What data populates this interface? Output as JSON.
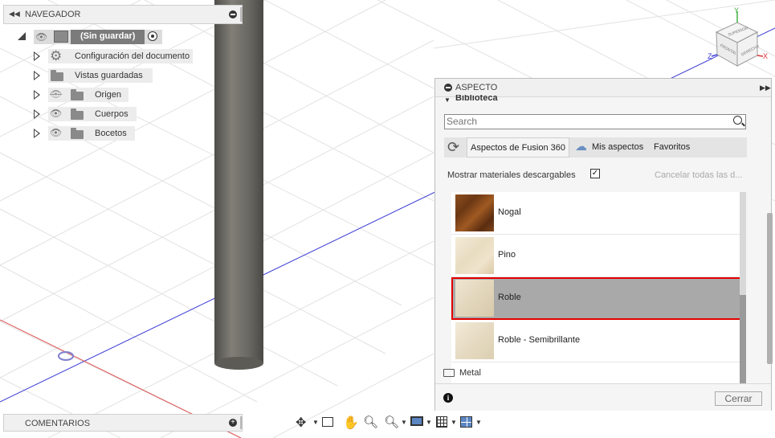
{
  "navigator": {
    "title": "NAVEGADOR",
    "root_label": "(Sin guardar)",
    "items": [
      {
        "label": "Configuración del documento",
        "icon": "gear-icon"
      },
      {
        "label": "Vistas guardadas",
        "icon": "folder-icon"
      },
      {
        "label": "Origen",
        "icon": "folder-icon",
        "visibility": "hidden"
      },
      {
        "label": "Cuerpos",
        "icon": "folder-icon",
        "visibility": "visible"
      },
      {
        "label": "Bocetos",
        "icon": "folder-icon",
        "visibility": "visible"
      }
    ]
  },
  "viewcube": {
    "faces": [
      "SUPERIOR",
      "FRONTAL",
      "DERECHA"
    ],
    "axes": {
      "x": "X",
      "y": "Y",
      "z": "Z"
    }
  },
  "aspecto": {
    "title": "ASPECTO",
    "section": "Biblioteca",
    "search": {
      "placeholder": "Search",
      "value": ""
    },
    "tabs": [
      {
        "label": "Aspectos de Fusion 360",
        "active": true
      },
      {
        "label": "Mis aspectos",
        "active": false
      },
      {
        "label": "Favoritos",
        "active": false
      }
    ],
    "show_downloadable_label": "Mostrar materiales descargables",
    "show_downloadable_checked": true,
    "cancel_all_label": "Cancelar todas las d...",
    "materials": [
      {
        "label": "Nogal",
        "selected": false
      },
      {
        "label": "Pino",
        "selected": false
      },
      {
        "label": "Roble",
        "selected": true
      },
      {
        "label": "Roble - Semibrillante",
        "selected": false
      }
    ],
    "folder_label": "Metal",
    "close_label": "Cerrar"
  },
  "comments": {
    "title": "COMENTARIOS"
  },
  "colors": {
    "selection_border": "#e30000",
    "selection_bg": "#a9a9a9",
    "grid": "#e4e4e4",
    "axis_blue": "#3a3ad6",
    "axis_red": "#e03030",
    "cylinder": "#6e6c66"
  }
}
